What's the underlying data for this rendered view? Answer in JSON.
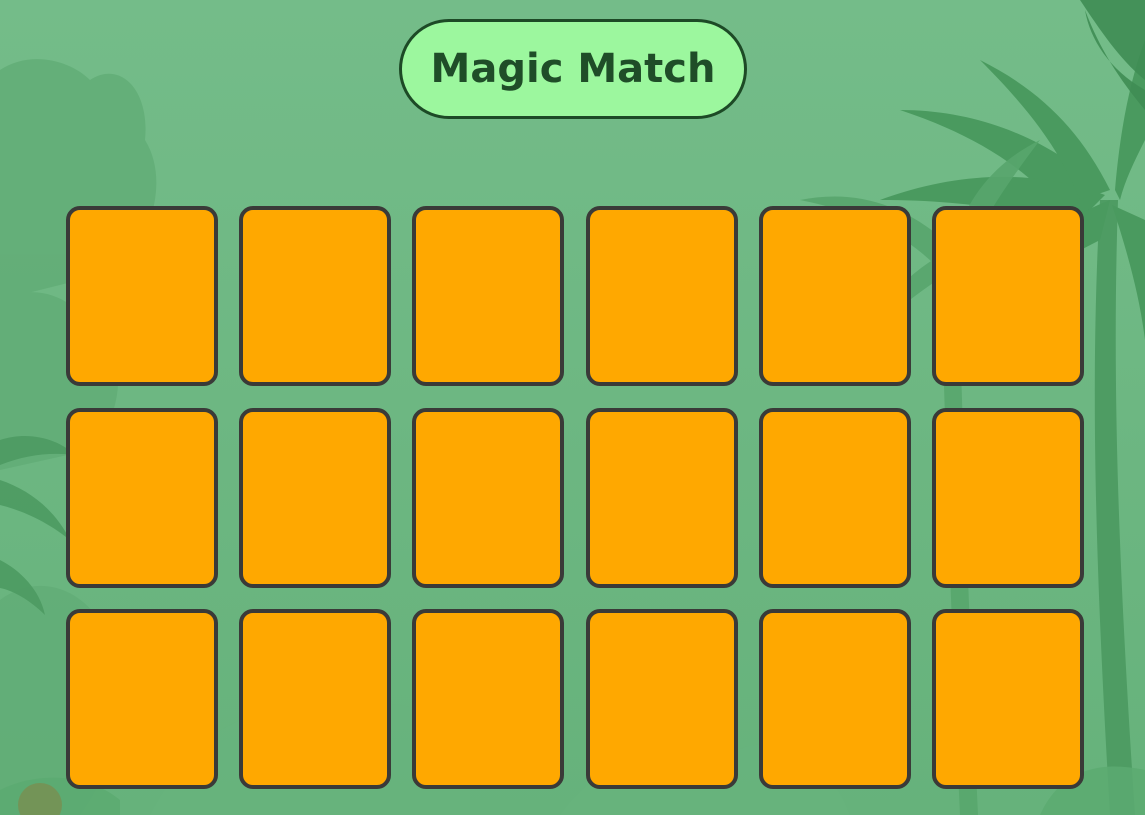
{
  "game": {
    "title": "Magic Match"
  },
  "theme": {
    "background": "#6db883",
    "title_background": "#9cf79e",
    "title_border": "#1d4a26",
    "title_text": "#1f4d28",
    "card_back": "#ffa800",
    "card_border": "#3a3a38",
    "foliage_dark": "#3f8d54",
    "foliage_light": "#5aa870"
  },
  "board": {
    "rows": 3,
    "columns": 6,
    "cards": [
      {
        "row": 1,
        "column": 1,
        "face_down": true
      },
      {
        "row": 1,
        "column": 2,
        "face_down": true
      },
      {
        "row": 1,
        "column": 3,
        "face_down": true
      },
      {
        "row": 1,
        "column": 4,
        "face_down": true
      },
      {
        "row": 1,
        "column": 5,
        "face_down": true
      },
      {
        "row": 1,
        "column": 6,
        "face_down": true
      },
      {
        "row": 2,
        "column": 1,
        "face_down": true
      },
      {
        "row": 2,
        "column": 2,
        "face_down": true
      },
      {
        "row": 2,
        "column": 3,
        "face_down": true
      },
      {
        "row": 2,
        "column": 4,
        "face_down": true
      },
      {
        "row": 2,
        "column": 5,
        "face_down": true
      },
      {
        "row": 2,
        "column": 6,
        "face_down": true
      },
      {
        "row": 3,
        "column": 1,
        "face_down": true
      },
      {
        "row": 3,
        "column": 2,
        "face_down": true
      },
      {
        "row": 3,
        "column": 3,
        "face_down": true
      },
      {
        "row": 3,
        "column": 4,
        "face_down": true
      },
      {
        "row": 3,
        "column": 5,
        "face_down": true
      },
      {
        "row": 3,
        "column": 6,
        "face_down": true
      }
    ]
  },
  "background_scene": {
    "icons": [
      "jungle-backdrop",
      "palm-tree-icon",
      "fern-icon",
      "bush-icon"
    ]
  }
}
